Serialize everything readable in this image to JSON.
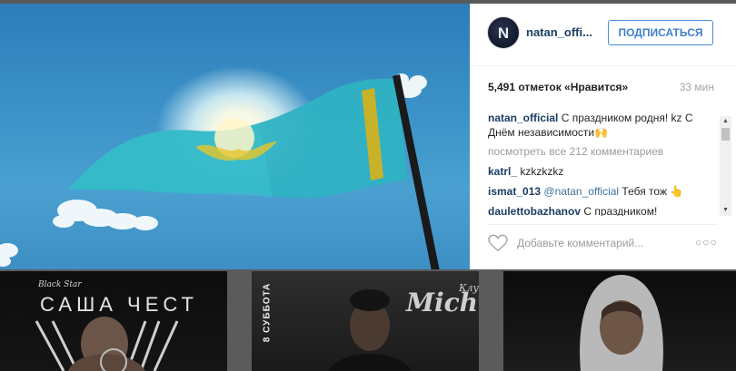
{
  "post": {
    "username": "natan_offi...",
    "avatar_letter": "N",
    "follow_label": "ПОДПИСАТЬСЯ",
    "likes": "5,491 отметок «Нравится»",
    "time": "33 мин",
    "caption": {
      "user": "natan_official",
      "text": "С праздником родня! kz С Днём независимости🙌"
    },
    "view_all_comments": "посмотреть все 212 комментариев",
    "comments": [
      {
        "user": "katrl_",
        "text": "kzkzkzkz"
      },
      {
        "user": "ismat_013",
        "mention": "@natan_official",
        "text": "Тебя тож 👆"
      },
      {
        "user": "daulettobazhanov",
        "text": "С праздником!"
      }
    ],
    "add_comment_placeholder": "Добавьте комментарий...",
    "more_options": "○○○"
  },
  "thumbnails": [
    {
      "script": "Black Star",
      "title": "САША ЧЕСТ"
    },
    {
      "vertical": "8 СУББОТА",
      "word": "Mich",
      "small": "Клуб"
    },
    {}
  ],
  "colors": {
    "accent_blue": "#3f7fcb",
    "username_navy": "#1a3e63",
    "flag_blue": "#31b7c9",
    "flag_gold": "#f0c419"
  },
  "icons": [
    "heart-icon",
    "more-options-icon",
    "scroll-up-icon",
    "scroll-down-icon"
  ]
}
